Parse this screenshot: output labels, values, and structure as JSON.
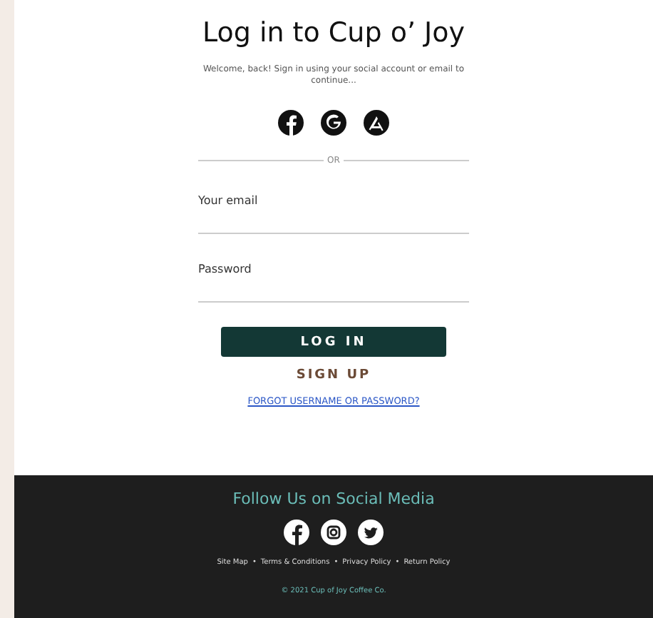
{
  "title": "Log in to Cup o’ Joy",
  "subtitle": "Welcome, back! Sign in using your social account or email to continue...",
  "social_login": [
    {
      "kind": "facebook"
    },
    {
      "kind": "google"
    },
    {
      "kind": "appstore"
    }
  ],
  "divider": "OR",
  "fields": [
    {
      "label": "Your email"
    },
    {
      "label": "Password"
    }
  ],
  "login_button": "LOG IN",
  "signup_button": "SIGN UP",
  "forgot_link": "FORGOT USERNAME OR PASSWORD?",
  "footer": {
    "heading": "Follow Us on Social Media",
    "social": [
      {
        "kind": "facebook"
      },
      {
        "kind": "instagram"
      },
      {
        "kind": "twitter"
      }
    ],
    "links": [
      {
        "label": "Site Map"
      },
      {
        "bullet": "•",
        "label": "Terms & Conditions"
      },
      {
        "bullet": "•",
        "label": "Privacy Policy"
      },
      {
        "bullet": "•",
        "label": "Return Policy"
      }
    ],
    "copyright": "© 2021 Cup of Joy Coffee Co."
  }
}
